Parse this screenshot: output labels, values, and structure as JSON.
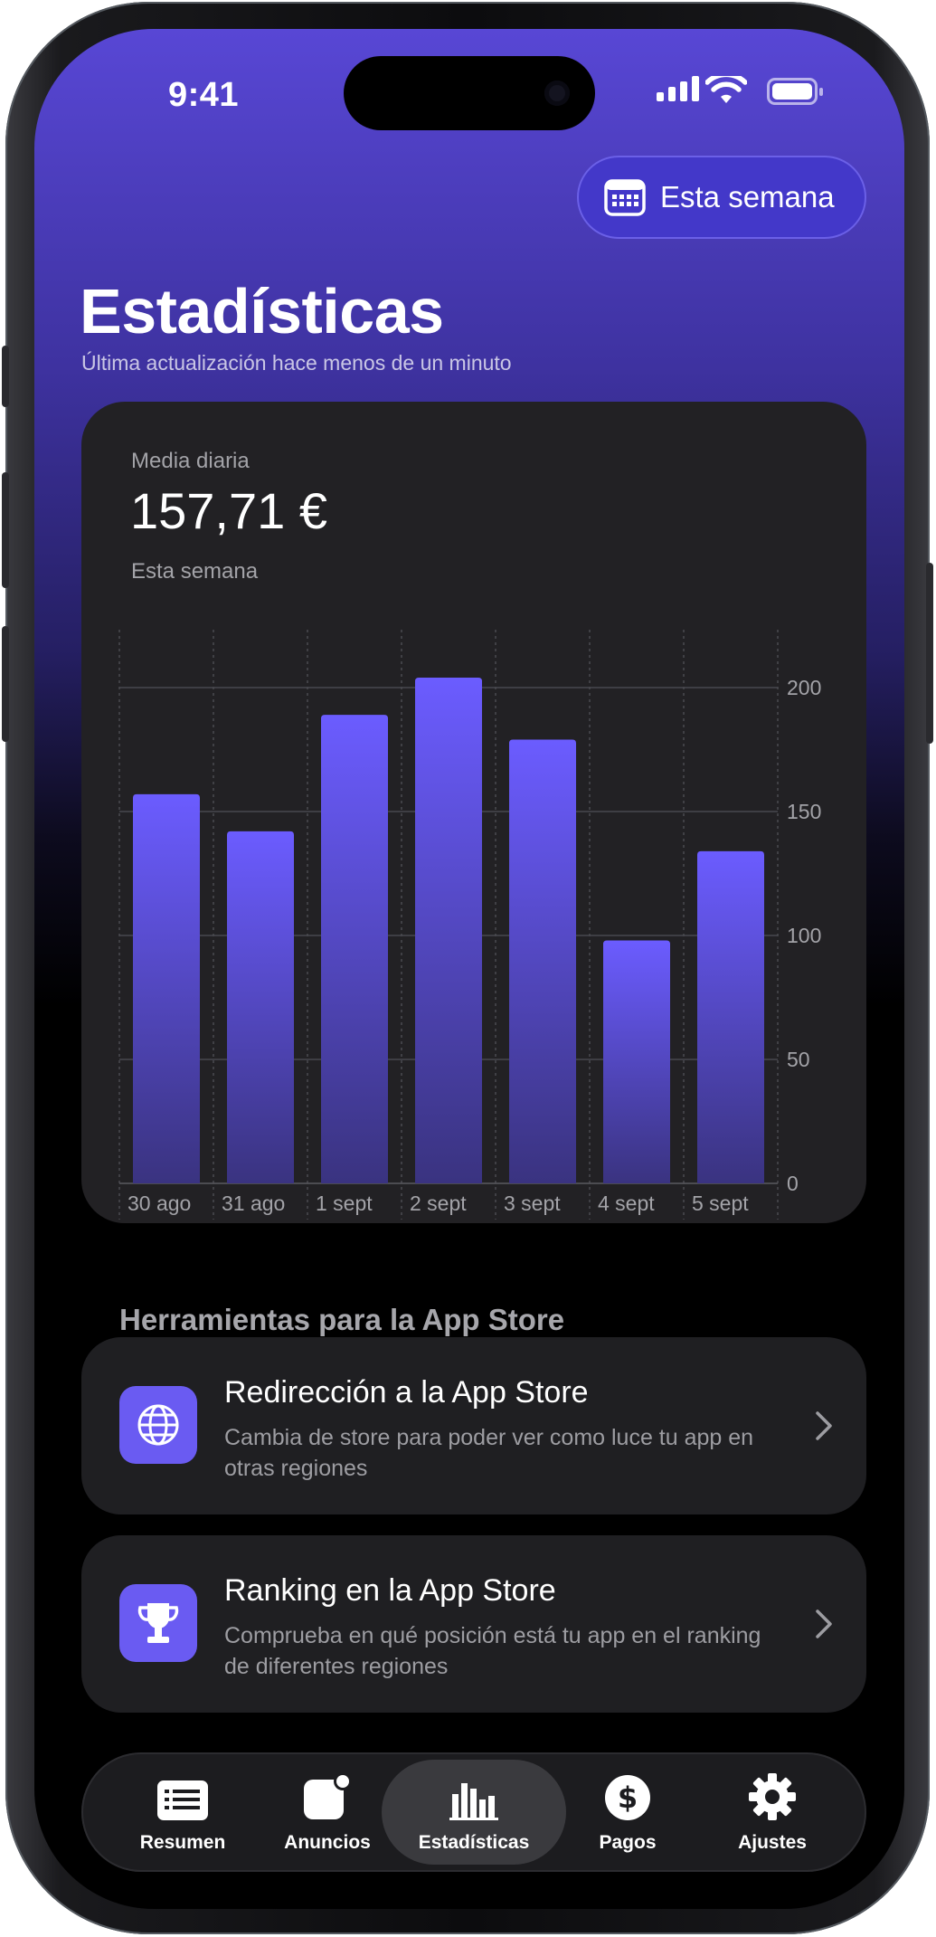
{
  "status": {
    "time": "9:41"
  },
  "header": {
    "period_button": "Esta semana",
    "title": "Estadísticas",
    "subtitle": "Última actualización hace menos de un minuto"
  },
  "summary": {
    "label": "Media diaria",
    "value": "157,71 €",
    "period": "Esta semana"
  },
  "chart_data": {
    "type": "bar",
    "categories": [
      "30 ago",
      "31 ago",
      "1 sept",
      "2 sept",
      "3 sept",
      "4 sept",
      "5 sept"
    ],
    "values": [
      157,
      142,
      189,
      204,
      179,
      98,
      134
    ],
    "ylim": [
      0,
      225
    ],
    "yticks": [
      0,
      50,
      100,
      150,
      200
    ],
    "y_axis_side": "right",
    "grid": true,
    "bar_color_top": "#6b5cff",
    "bar_color_bottom": "#3a3380"
  },
  "tools": {
    "section_title": "Herramientas para la App Store",
    "items": [
      {
        "title": "Redirección a la App Store",
        "description": "Cambia de store para poder ver como luce tu app en otras regiones",
        "icon": "globe-icon"
      },
      {
        "title": "Ranking en la App Store",
        "description": "Comprueba en qué posición está tu app en el ranking de diferentes regiones",
        "icon": "trophy-icon"
      }
    ]
  },
  "tabbar": {
    "items": [
      {
        "label": "Resumen",
        "icon": "list-icon"
      },
      {
        "label": "Anuncios",
        "icon": "announcement-icon"
      },
      {
        "label": "Estadísticas",
        "icon": "chart-icon",
        "active": true
      },
      {
        "label": "Pagos",
        "icon": "dollar-icon"
      },
      {
        "label": "Ajustes",
        "icon": "gear-icon"
      }
    ]
  },
  "colors": {
    "accent": "#6a5bf2",
    "card": "#222124",
    "header_top": "#5847d5"
  }
}
